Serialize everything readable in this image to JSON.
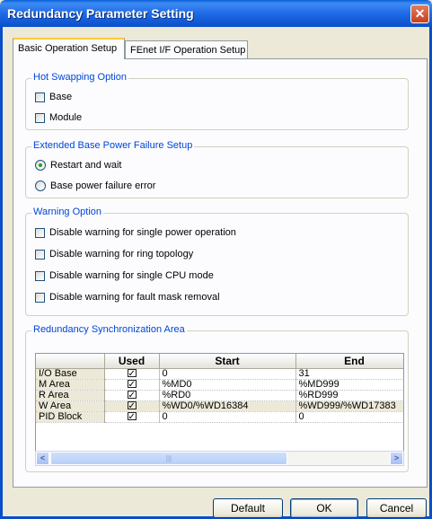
{
  "window": {
    "title": "Redundancy Parameter Setting",
    "close_glyph": "✕"
  },
  "tabs": [
    {
      "label": "Basic Operation Setup",
      "active": true
    },
    {
      "label": "FEnet I/F Operation Setup",
      "active": false
    }
  ],
  "hot_swapping": {
    "title": "Hot Swapping Option",
    "options": [
      {
        "label": "Base",
        "checked": false
      },
      {
        "label": "Module",
        "checked": false
      }
    ]
  },
  "power_failure": {
    "title": "Extended Base Power Failure Setup",
    "options": [
      {
        "label": "Restart and wait",
        "selected": true
      },
      {
        "label": "Base power failure error",
        "selected": false
      }
    ]
  },
  "warning": {
    "title": "Warning Option",
    "options": [
      {
        "label": "Disable warning for single power operation",
        "checked": false
      },
      {
        "label": "Disable warning for ring topology",
        "checked": false
      },
      {
        "label": "Disable warning for single CPU mode",
        "checked": false
      },
      {
        "label": "Disable warning for fault mask removal",
        "checked": false
      }
    ]
  },
  "sync_area": {
    "title": "Redundancy Synchronization Area",
    "columns": [
      "",
      "Used",
      "Start",
      "End"
    ],
    "check_glyph": "✓",
    "rows": [
      {
        "name": "I/O Base",
        "used": true,
        "start": "0",
        "end": "31"
      },
      {
        "name": "M Area",
        "used": true,
        "start": "%MD0",
        "end": "%MD999"
      },
      {
        "name": "R Area",
        "used": true,
        "start": "%RD0",
        "end": "%RD999"
      },
      {
        "name": "W Area",
        "used": true,
        "start": "%WD0/%WD16384",
        "end": "%WD999/%WD17383"
      },
      {
        "name": "PID Block",
        "used": true,
        "start": "0",
        "end": "0"
      }
    ],
    "scroll_left": "<",
    "scroll_right": ">",
    "scroll_thumb_grip": "|||"
  },
  "buttons": {
    "default": "Default",
    "ok": "OK",
    "cancel": "Cancel"
  },
  "colors": {
    "title_bar": "#1f6ae6",
    "group_label": "#0046d5",
    "active_tab_accent": "#ffc83c"
  }
}
